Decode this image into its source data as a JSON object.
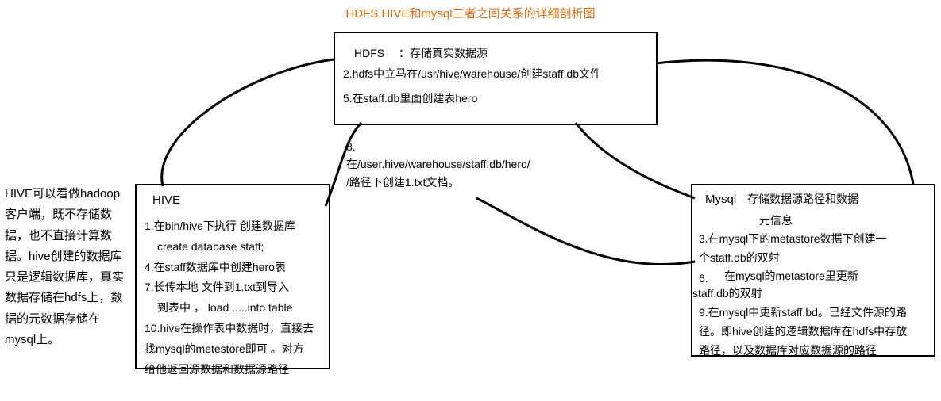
{
  "title": "HDFS,HIVE和mysql三者之间关系的详细剖析图",
  "hdfs": {
    "label": "HDFS",
    "desc": "：存储真实数据源",
    "line2": "2.hdfs中立马在/usr/hive/warehouse/创建staff.db文件",
    "line5": "5.在staff.db里面创建表hero"
  },
  "step8": {
    "num": "8.",
    "txt1": "在/user.hive/warehouse/staff.db/hero/",
    "txt2": "/路径下创建1.txt文档。"
  },
  "hive": {
    "label": "HIVE",
    "line1": "1.在bin/hive下执行 创建数据库",
    "line1b": "create database staff;",
    "line4": "4.在staff数据库中创建hero表",
    "line7": "7.长传本地 文件到1.txt到导入",
    "line7b": "到表中 ， load .....into  table",
    "line10": "10.hive在操作表中数据时，直接去",
    "line10b": "找mysql的metestore即可 。对方",
    "line10c": "给他返回源数据和数据源路径"
  },
  "mysql": {
    "label": "Mysql",
    "desc1": "存储数据源路径和数据",
    "desc2": "元信息",
    "line3a": "3.在mysql下的metastore数据下创建一",
    "line3b": "个staff.db的双射",
    "step6num": "6.",
    "step6txt": "在mysql的metastore里更新",
    "step6txt2": "staff.db的双射",
    "line9a": "9.在mysql中更新staff.bd。已经文件源的路",
    "line9b": "径。即hive创建的逻辑数据库在hdfs中存放",
    "line9c": "路径，以及数据库对应数据源的路径"
  },
  "sidenote": "HIVE可以看做hadoop客户端，既不存储数据，也不直接计算数据。hive创建的数据库只是逻辑数据库，真实 数据存储在hdfs上，数据的元数据存储在mysql上。",
  "chart_data": {
    "type": "diagram",
    "nodes": [
      {
        "id": "HDFS",
        "role": "存储真实数据源"
      },
      {
        "id": "HIVE",
        "role": "hadoop客户端/逻辑数据库"
      },
      {
        "id": "Mysql",
        "role": "存储数据源路径和数据元信息(metastore)"
      }
    ],
    "steps": [
      {
        "n": 1,
        "at": "HIVE",
        "text": "在bin/hive下执行 创建数据库 create database staff;"
      },
      {
        "n": 2,
        "at": "HDFS",
        "text": "hdfs中立马在/usr/hive/warehouse/创建staff.db文件"
      },
      {
        "n": 3,
        "at": "Mysql",
        "text": "在mysql下的metastore数据下创建一个staff.db的双射"
      },
      {
        "n": 4,
        "at": "HIVE",
        "text": "在staff数据库中创建hero表"
      },
      {
        "n": 5,
        "at": "HDFS",
        "text": "在staff.db里面创建表hero"
      },
      {
        "n": 6,
        "at": "Mysql",
        "text": "在mysql的metastore里更新staff.db的双射"
      },
      {
        "n": 7,
        "at": "HIVE",
        "text": "长传本地文件到1.txt到导入到表中，load .....into table"
      },
      {
        "n": 8,
        "at": "HDFS",
        "text": "在/user.hive/warehouse/staff.db/hero/路径下创建1.txt文档。"
      },
      {
        "n": 9,
        "at": "Mysql",
        "text": "在mysql中更新staff.bd。已经文件源的路径。即hive创建的逻辑数据库在hdfs中存放路径，以及数据库对应数据源的路径"
      },
      {
        "n": 10,
        "at": "HIVE",
        "text": "hive在操作表中数据时，直接去找mysql的metestore即可。对方给他返回源数据和数据源路径"
      }
    ],
    "edges": [
      {
        "from": "HIVE",
        "to": "HDFS"
      },
      {
        "from": "HDFS",
        "to": "Mysql"
      },
      {
        "from": "HIVE",
        "to": "Mysql"
      }
    ]
  }
}
